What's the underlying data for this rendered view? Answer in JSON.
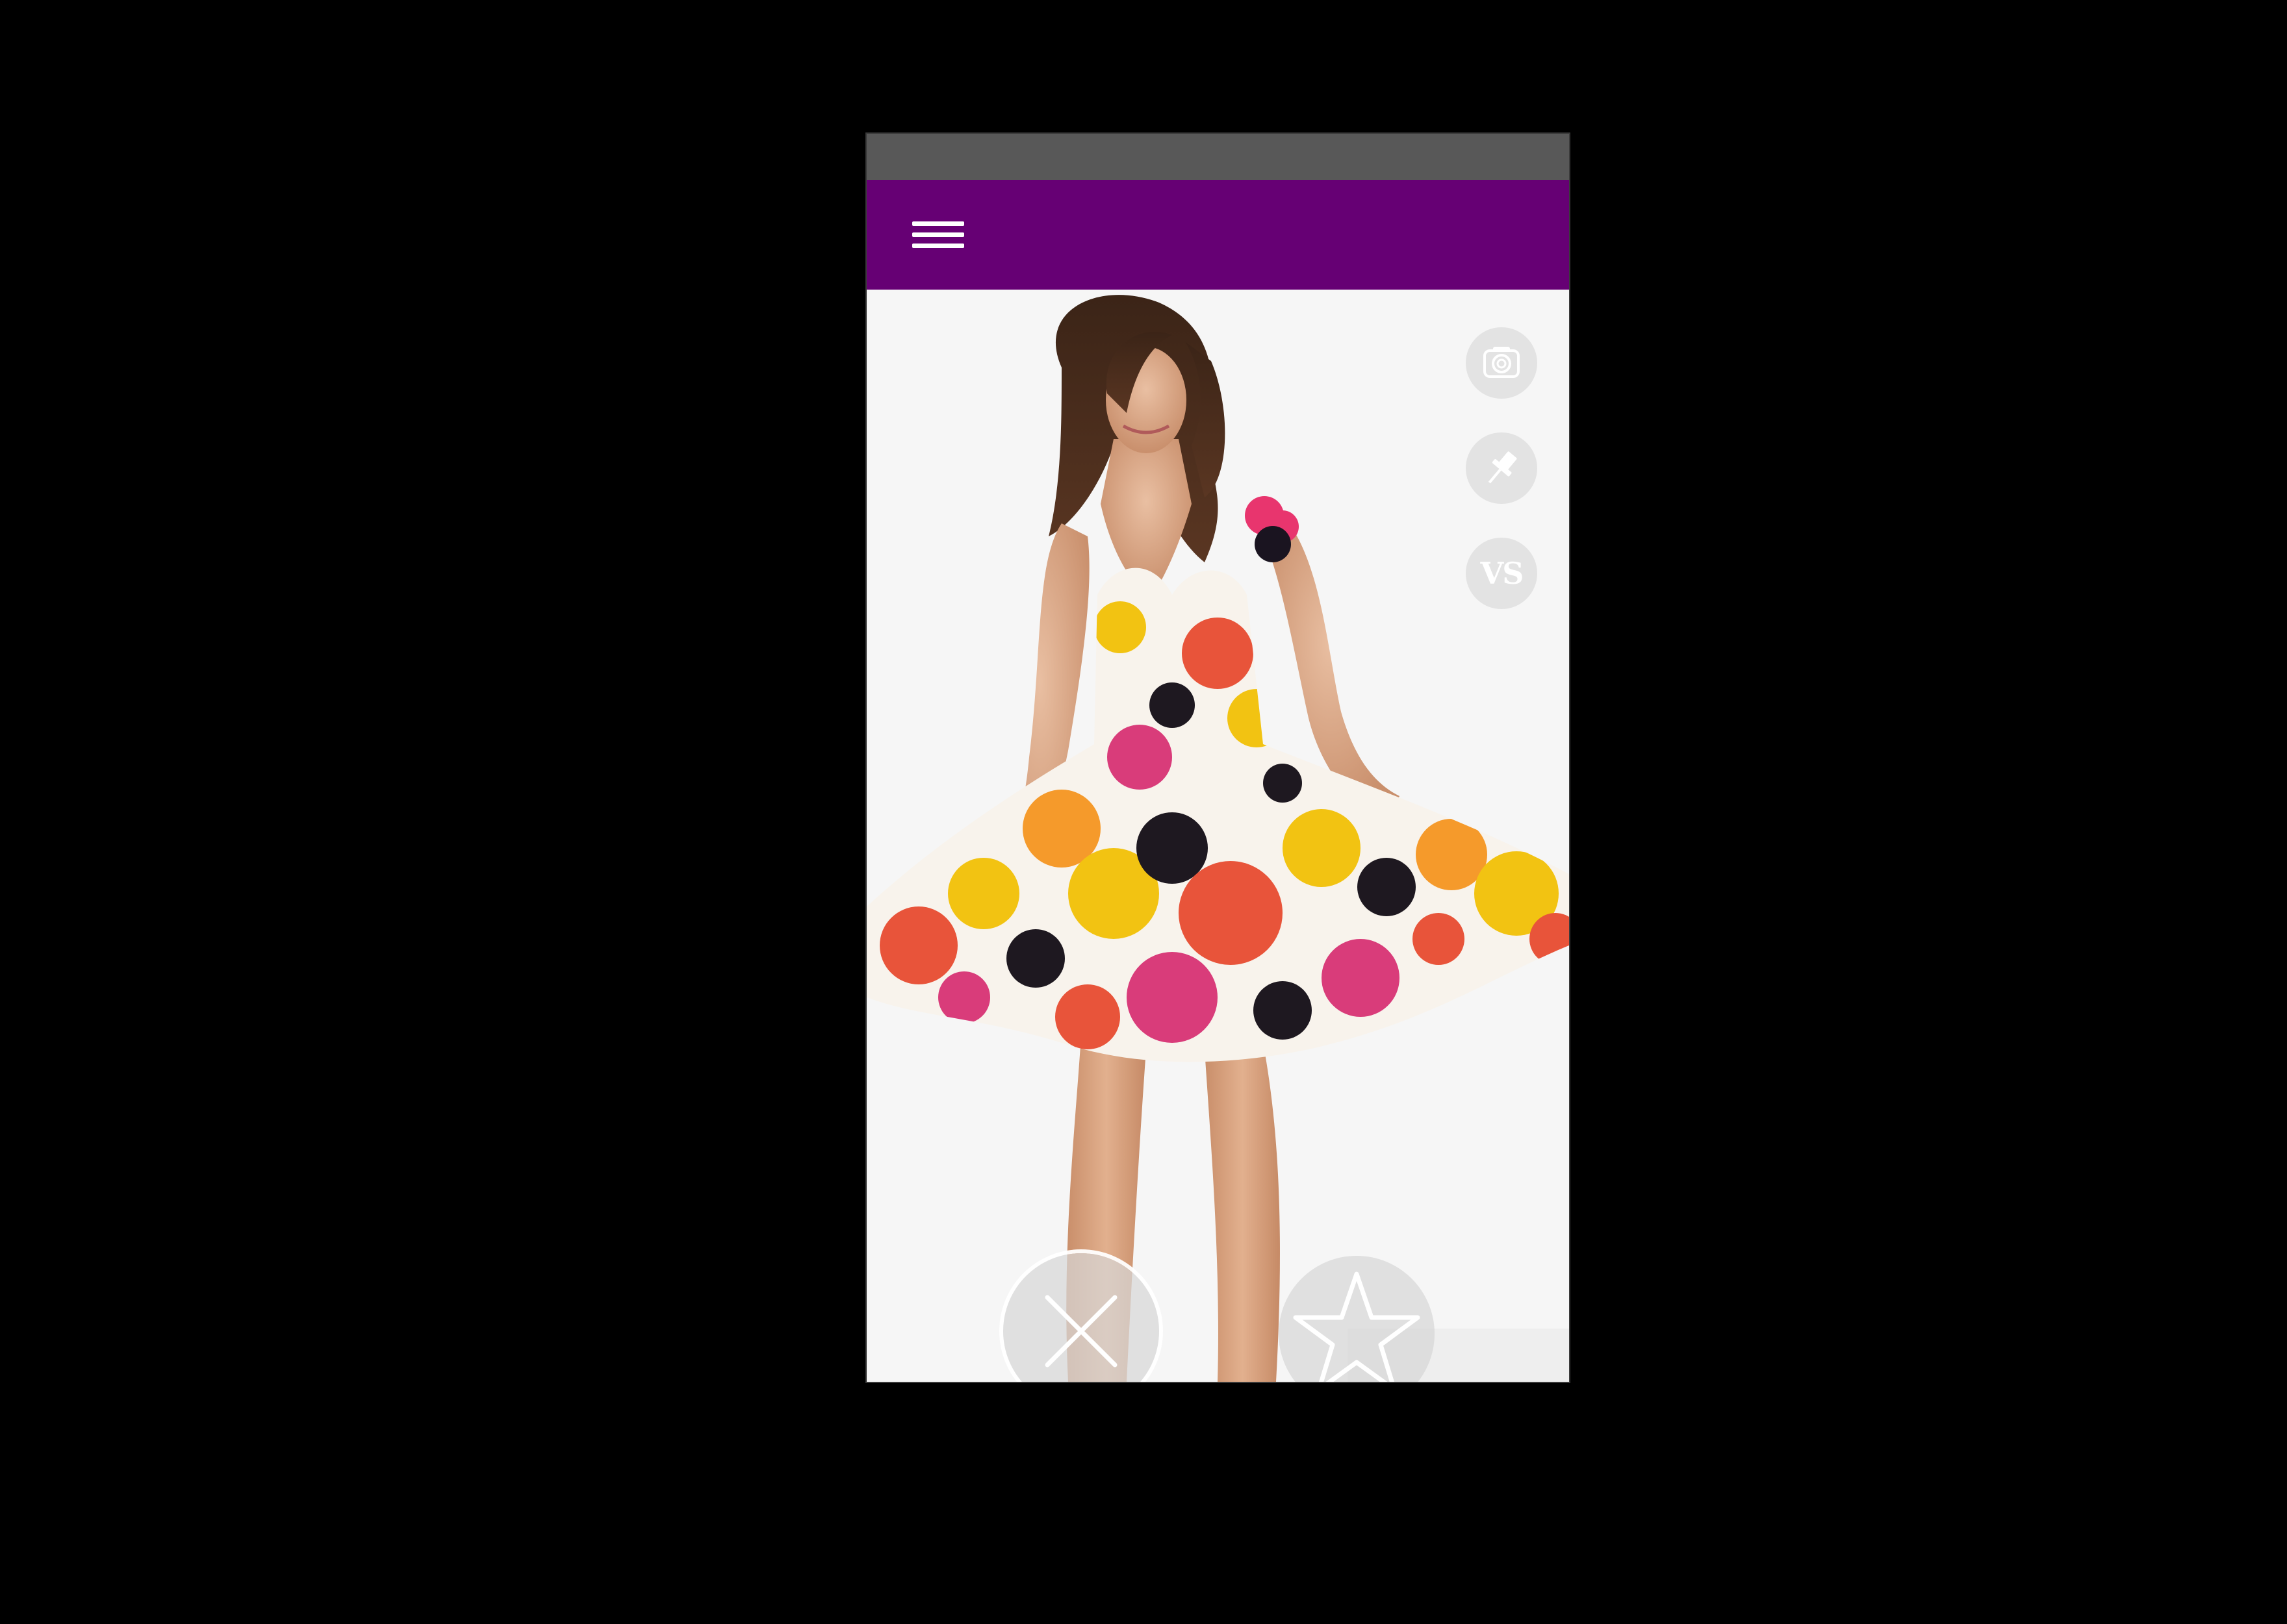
{
  "colors": {
    "background": "#000000",
    "status_bar": "#585858",
    "app_bar": "#660074",
    "button_fill": "#d7d7d7",
    "icon": "#ffffff"
  },
  "app_bar": {
    "menu_icon": "hamburger-menu-icon"
  },
  "photo": {
    "subject": "model-in-floral-dress-photo"
  },
  "side_actions": {
    "camera_icon": "camera-icon",
    "pin_icon": "pushpin-icon",
    "vs_label": "VS"
  },
  "bottom_actions": {
    "dismiss_icon": "close-x-icon",
    "favorite_icon": "star-icon"
  }
}
